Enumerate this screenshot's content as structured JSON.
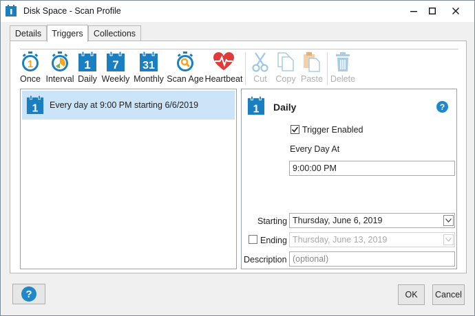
{
  "window": {
    "title": "Disk Space - Scan Profile"
  },
  "tabs": [
    {
      "label": "Details"
    },
    {
      "label": "Triggers",
      "active": true
    },
    {
      "label": "Collections"
    }
  ],
  "toolbar": {
    "items": [
      {
        "label": "Once",
        "icon": "stopwatch-1-icon",
        "enabled": true
      },
      {
        "label": "Interval",
        "icon": "stopwatch-interval-icon",
        "enabled": true
      },
      {
        "label": "Daily",
        "icon": "calendar-1-icon",
        "enabled": true
      },
      {
        "label": "Weekly",
        "icon": "calendar-7-icon",
        "enabled": true
      },
      {
        "label": "Monthly",
        "icon": "calendar-31-icon",
        "enabled": true
      },
      {
        "label": "Scan Age",
        "icon": "stopwatch-search-icon",
        "enabled": true
      },
      {
        "label": "Heartbeat",
        "icon": "heartbeat-icon",
        "enabled": true
      },
      {
        "label": "Cut",
        "icon": "scissors-icon",
        "enabled": false
      },
      {
        "label": "Copy",
        "icon": "copy-icon",
        "enabled": false
      },
      {
        "label": "Paste",
        "icon": "paste-icon",
        "enabled": false
      },
      {
        "label": "Delete",
        "icon": "trash-icon",
        "enabled": false
      }
    ]
  },
  "calendar_numbers": {
    "daily": "1",
    "weekly": "7",
    "monthly": "31"
  },
  "triggers_list": [
    {
      "text": "Every day at 9:00 PM starting 6/6/2019",
      "icon": "calendar-1-icon",
      "selected": true
    }
  ],
  "detail": {
    "title": "Daily",
    "help_glyph": "?",
    "trigger_enabled_label": "Trigger Enabled",
    "trigger_enabled": true,
    "every_day_at_label": "Every Day At",
    "time_value": "9:00:00 PM",
    "starting_label": "Starting",
    "starting_value": "Thursday, June 6, 2019",
    "ending_label": "Ending",
    "ending_checked": false,
    "ending_value": "Thursday, June 13, 2019",
    "description_label": "Description",
    "description_placeholder": "(optional)"
  },
  "footer": {
    "help_glyph": "?",
    "ok_label": "OK",
    "cancel_label": "Cancel"
  },
  "colors": {
    "accent": "#1e88c8",
    "calendar": "#1a7fc1",
    "stopwatch_ring": "#1a7fc1",
    "stopwatch_face": "#f5a623",
    "heart": "#e03a3a",
    "selection": "#cce4f7"
  }
}
